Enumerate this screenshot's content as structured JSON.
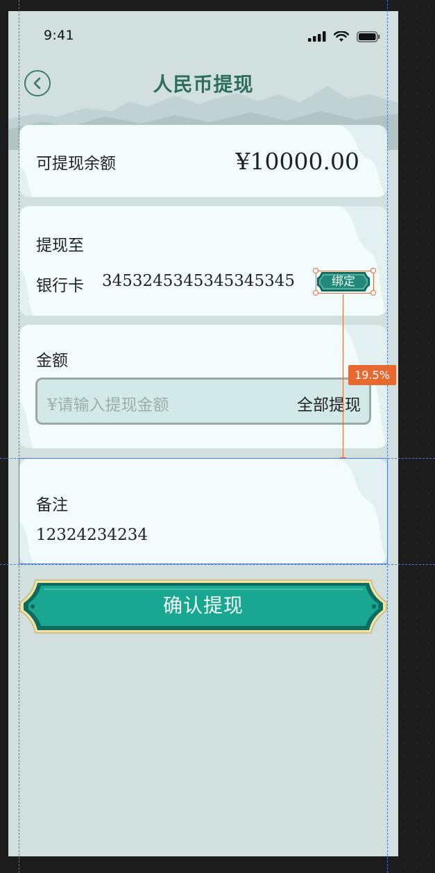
{
  "status_bar": {
    "time": "9:41"
  },
  "nav": {
    "title": "人民币提现"
  },
  "balance": {
    "label": "可提现余额",
    "amount": "¥10000.00"
  },
  "withdraw_to": {
    "label": "提现至",
    "account_type": "银行卡",
    "account_number": "3453245345345345345",
    "bind_label": "绑定"
  },
  "amount": {
    "label": "金额",
    "placeholder": "¥请输入提现金额",
    "all_label": "全部提现"
  },
  "remark": {
    "label": "备注",
    "value": "12324234234"
  },
  "confirm": {
    "label": "确认提现"
  },
  "measurement": {
    "value": "19.5%"
  },
  "colors": {
    "background": "#d1dfdf",
    "card": "#f2fcfd",
    "accent": "#1f9d8a",
    "title": "#2e6e5c",
    "annotation": "#e8692f",
    "guide": "#4a78d8"
  },
  "icons": [
    "back-arrow-icon",
    "signal-icon",
    "wifi-icon",
    "battery-icon"
  ]
}
